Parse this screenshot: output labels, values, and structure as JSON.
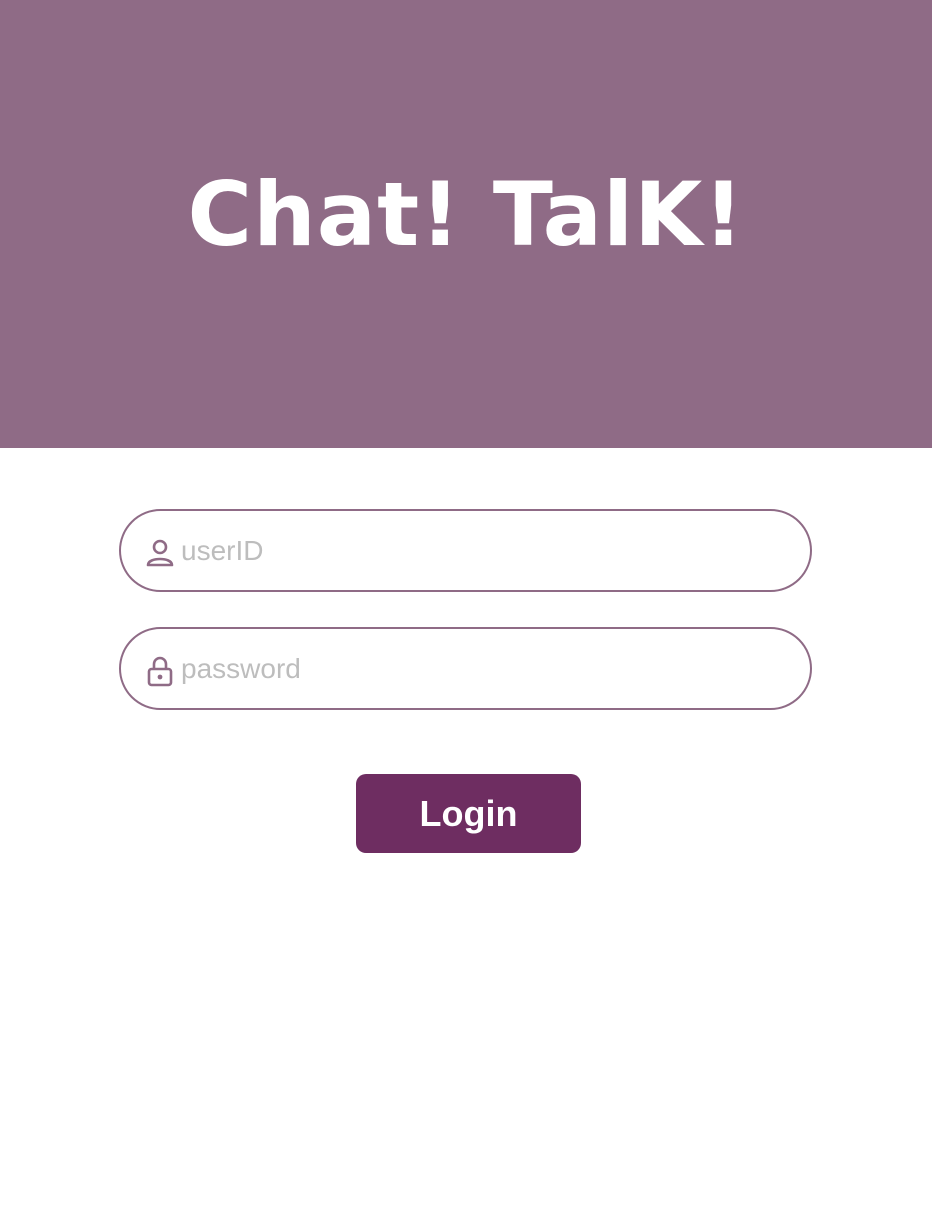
{
  "header": {
    "title": "Chat! TalK!"
  },
  "login_form": {
    "userid": {
      "icon": "user-icon",
      "placeholder": "userID",
      "value": ""
    },
    "password": {
      "icon": "lock-icon",
      "placeholder": "password",
      "value": ""
    },
    "login_label": "Login"
  },
  "colors": {
    "header_bg": "#8f6b86",
    "button_bg": "#6e2d61",
    "field_border": "#8f6b86",
    "placeholder": "#bdbdbd"
  }
}
